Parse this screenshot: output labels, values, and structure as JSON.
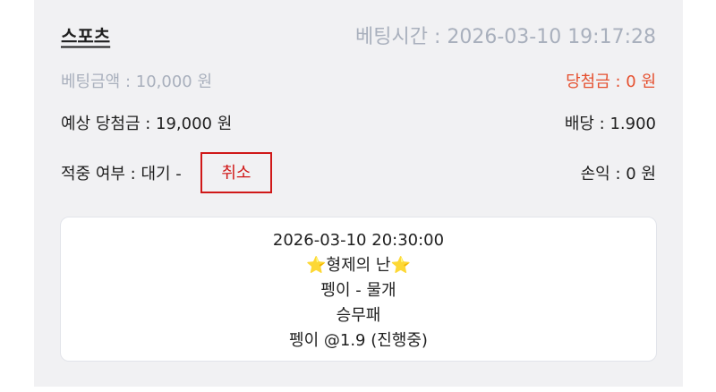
{
  "header": {
    "category": "스포츠",
    "bet_time": "베팅시간 : 2026-03-10 19:17:28"
  },
  "summary": {
    "bet_amount": "베팅금액 : 10,000 원",
    "winnings": "당첨금 : 0 원",
    "expected_winnings": "예상 당첨금 : 19,000 원",
    "odds": "배당 : 1.900",
    "hit_status": "적중 여부 : 대기 -",
    "cancel_label": "취소",
    "profit": "손익 : 0 원"
  },
  "match": {
    "datetime": "2026-03-10 20:30:00",
    "star_left": "⭐",
    "league": "형제의 난",
    "star_right": "⭐",
    "teams": "펭이 - 물개",
    "market": "승무패",
    "pick": "펭이 @1.9 (진행중)"
  },
  "colors": {
    "card_bg": "#f1f1f3",
    "muted_text": "#a9b0bd",
    "winnings_red": "#e5502f",
    "cancel_red": "#d01818"
  }
}
